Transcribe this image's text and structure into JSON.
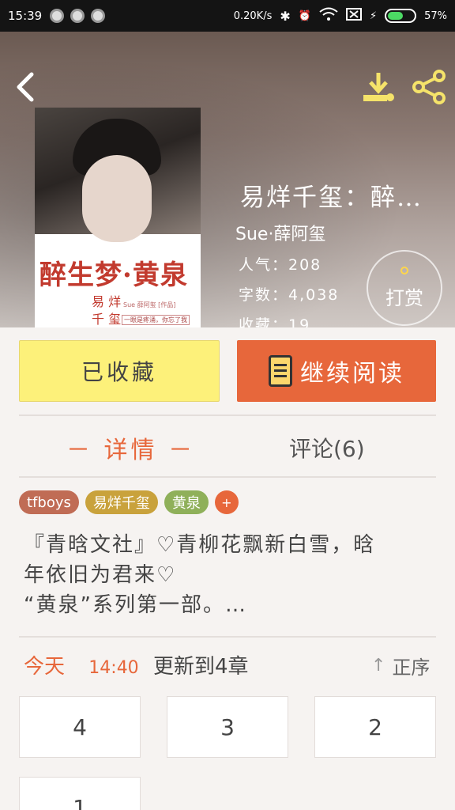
{
  "status_bar": {
    "time": "15:39",
    "net_speed": "0.20K/s",
    "battery": "57%"
  },
  "book": {
    "title": "易烊千玺：醉…",
    "author": "Sue·薛阿玺",
    "popularity": "人气：208",
    "word_count": "字数：4,038",
    "favorites": "收藏：19",
    "tip_label": "打赏",
    "cover": {
      "title_art": "醉生梦·黄泉",
      "seal_line1": "易 烊",
      "seal_line2": "千 玺",
      "credit": "Sue 薛阿玺 [作品]",
      "tagline": "一眼是疼涌，你忘了我"
    }
  },
  "actions": {
    "collected_label": "已收藏",
    "continue_label": "继续阅读"
  },
  "tabs": {
    "detail": "－ 详情 －",
    "comments": "评论(6)"
  },
  "tags": [
    {
      "label": "tfboys",
      "color": "#c06c55"
    },
    {
      "label": "易烊千玺",
      "color": "#c9a23c"
    },
    {
      "label": "黄泉",
      "color": "#8fb05a"
    }
  ],
  "tag_add": "+",
  "synopsis": {
    "line1": "『青晗文社』♡青柳花飘新白雪，晗",
    "line2": "年依旧为君来♡",
    "line3": "“黄泉”系列第一部。…"
  },
  "update": {
    "today": "今天",
    "time": "14:40",
    "text": "更新到4章",
    "order_label": "正序"
  },
  "chapters": [
    "4",
    "3",
    "2",
    "1"
  ],
  "colors": {
    "accent": "#e7673b",
    "collected_bg": "#fdf17a",
    "tip_coin": "#ffd64a"
  }
}
